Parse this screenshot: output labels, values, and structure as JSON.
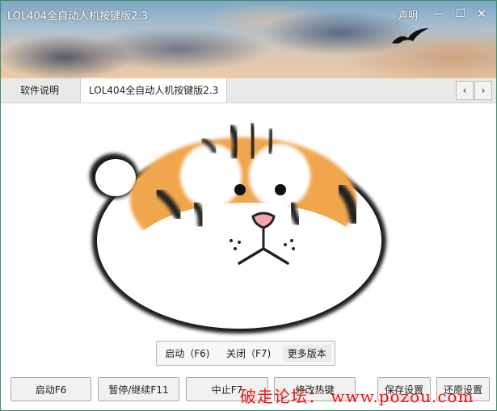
{
  "window": {
    "title": "LOL404全自动人机按键版2.3",
    "declare_label": "声明",
    "controls": {
      "minimize": "—",
      "maximize": "☐",
      "close": "✕"
    }
  },
  "tabs": [
    {
      "label": "软件说明",
      "active": false
    },
    {
      "label": "LOL404全自动人机按键版2.3",
      "active": true
    }
  ],
  "tab_nav": {
    "prev": "‹",
    "next": "›"
  },
  "hotkeys": [
    {
      "label": "启动（F6)"
    },
    {
      "label": "关闭（F7)"
    },
    {
      "label": "更多版本"
    }
  ],
  "buttons": {
    "start": "启动F6",
    "pause": "暂停/继续F11",
    "stop": "中止F7",
    "edit_hotkey": "修改热键",
    "save": "保存设置",
    "restore": "还原设置"
  },
  "watermark": "破走论坛： www.pozou.com",
  "colors": {
    "accent_border": "#3a8f6a",
    "watermark": "#ee1111"
  }
}
